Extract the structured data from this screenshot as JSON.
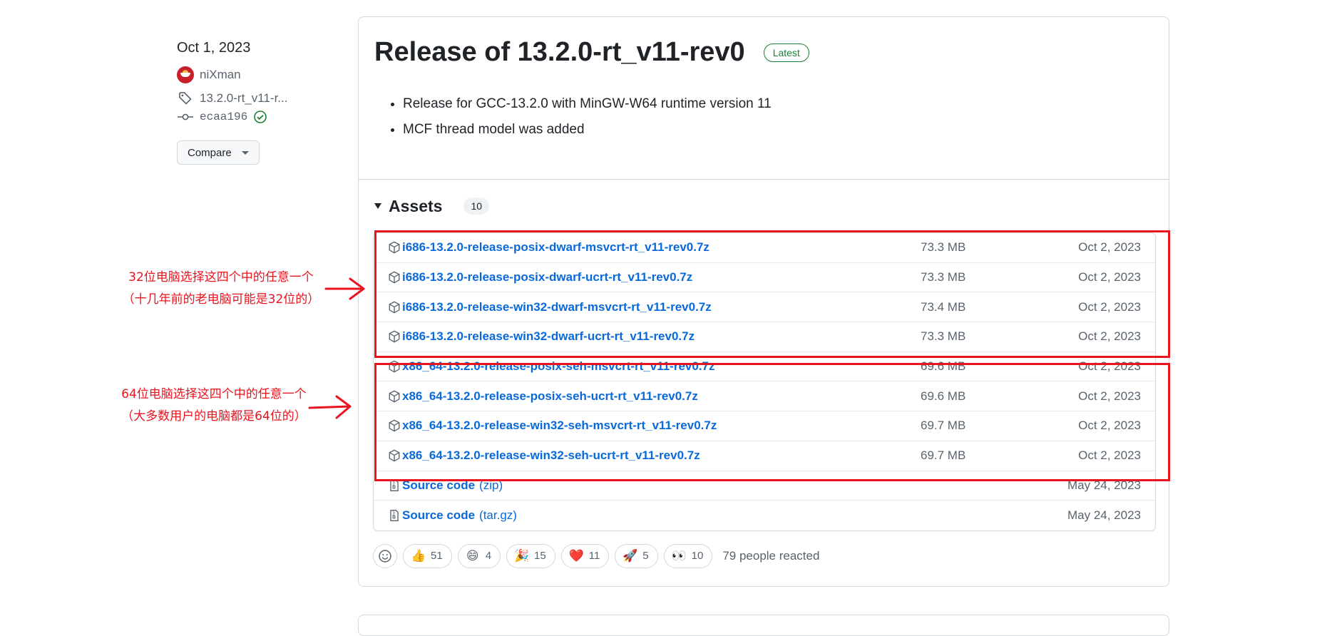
{
  "sidebar": {
    "date": "Oct 1, 2023",
    "author": "niXman",
    "tag": "13.2.0-rt_v11-r...",
    "commit": "ecaa196",
    "compare_label": "Compare"
  },
  "release": {
    "title": "Release of 13.2.0-rt_v11-rev0",
    "badge": "Latest",
    "notes": [
      "Release for GCC-13.2.0 with MinGW-W64 runtime version 11",
      "MCF thread model was added"
    ]
  },
  "assets": {
    "title": "Assets",
    "count": "10",
    "files": [
      {
        "name": "i686-13.2.0-release-posix-dwarf-msvcrt-rt_v11-rev0.7z",
        "size": "73.3 MB",
        "date": "Oct 2, 2023"
      },
      {
        "name": "i686-13.2.0-release-posix-dwarf-ucrt-rt_v11-rev0.7z",
        "size": "73.3 MB",
        "date": "Oct 2, 2023"
      },
      {
        "name": "i686-13.2.0-release-win32-dwarf-msvcrt-rt_v11-rev0.7z",
        "size": "73.4 MB",
        "date": "Oct 2, 2023"
      },
      {
        "name": "i686-13.2.0-release-win32-dwarf-ucrt-rt_v11-rev0.7z",
        "size": "73.3 MB",
        "date": "Oct 2, 2023"
      },
      {
        "name": "x86_64-13.2.0-release-posix-seh-msvcrt-rt_v11-rev0.7z",
        "size": "69.6 MB",
        "date": "Oct 2, 2023"
      },
      {
        "name": "x86_64-13.2.0-release-posix-seh-ucrt-rt_v11-rev0.7z",
        "size": "69.6 MB",
        "date": "Oct 2, 2023"
      },
      {
        "name": "x86_64-13.2.0-release-win32-seh-msvcrt-rt_v11-rev0.7z",
        "size": "69.7 MB",
        "date": "Oct 2, 2023"
      },
      {
        "name": "x86_64-13.2.0-release-win32-seh-ucrt-rt_v11-rev0.7z",
        "size": "69.7 MB",
        "date": "Oct 2, 2023"
      }
    ],
    "sources": [
      {
        "name": "Source code",
        "suffix": "(zip)",
        "date": "May 24, 2023"
      },
      {
        "name": "Source code",
        "suffix": "(tar.gz)",
        "date": "May 24, 2023"
      }
    ]
  },
  "reactions": {
    "items": [
      {
        "emoji": "👍",
        "count": "51"
      },
      {
        "emoji": "😄",
        "count": "4"
      },
      {
        "emoji": "🎉",
        "count": "15"
      },
      {
        "emoji": "❤️",
        "count": "11"
      },
      {
        "emoji": "🚀",
        "count": "5"
      },
      {
        "emoji": "👀",
        "count": "10"
      }
    ],
    "summary": "79 people reacted"
  },
  "annotations": {
    "color": "#e8141e",
    "group32": {
      "line1": "32位电脑选择这四个中的任意一个",
      "line2": "（十几年前的老电脑可能是32位的）"
    },
    "group64": {
      "line1": "64位电脑选择这四个中的任意一个",
      "line2": "（大多数用户的电脑都是64位的）"
    }
  }
}
